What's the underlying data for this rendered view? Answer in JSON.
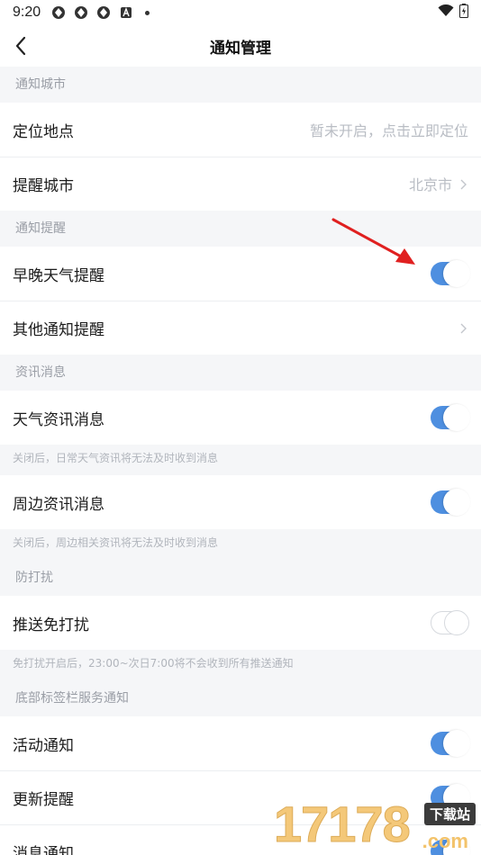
{
  "status_bar": {
    "time": "9:20"
  },
  "nav": {
    "title": "通知管理"
  },
  "sections": [
    {
      "header": "通知城市",
      "rows": [
        {
          "label": "定位地点",
          "value": "暂未开启，点击立即定位"
        },
        {
          "label": "提醒城市",
          "value": "北京市"
        }
      ]
    },
    {
      "header": "通知提醒",
      "rows": [
        {
          "label": "早晚天气提醒",
          "toggle": "on"
        },
        {
          "label": "其他通知提醒"
        }
      ]
    },
    {
      "header": "资讯消息",
      "rows": [
        {
          "label": "天气资讯消息",
          "toggle": "on",
          "note": "关闭后，日常天气资讯将无法及时收到消息"
        },
        {
          "label": "周边资讯消息",
          "toggle": "on",
          "note": "关闭后，周边相关资讯将无法及时收到消息"
        }
      ]
    },
    {
      "header": "防打扰",
      "rows": [
        {
          "label": "推送免打扰",
          "toggle": "off",
          "note": "免打扰开启后，23:00~次日7:00将不会收到所有推送通知"
        }
      ]
    },
    {
      "header": "底部标签栏服务通知",
      "rows": [
        {
          "label": "活动通知",
          "toggle": "on"
        },
        {
          "label": "更新提醒",
          "toggle": "on"
        },
        {
          "label": "消息通知",
          "toggle": "on"
        }
      ]
    }
  ],
  "watermark": {
    "number": "17178",
    "tag": "下载站",
    "domain": ".com"
  },
  "colors": {
    "toggle_on": "#4e8fe0",
    "annotation_arrow": "#e02020"
  }
}
